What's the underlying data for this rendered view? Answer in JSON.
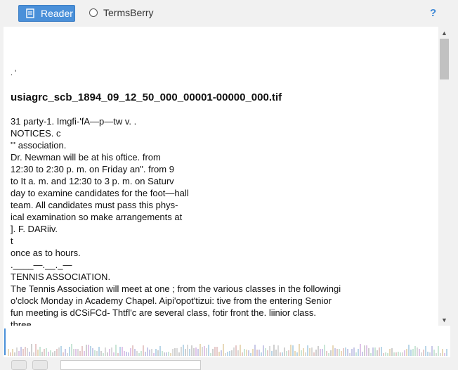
{
  "toolbar": {
    "reader_label": "Reader",
    "termsberry_label": "TermsBerry",
    "help_label": "?"
  },
  "document": {
    "mark": ". '",
    "title": "usiagrc_scb_1894_09_12_50_000_00001-00000_000.tif",
    "lines": [
      "31 party-1. Imgfi-'fA—p—tw v. .",
      "NOTICES. c",
      "\"' association.",
      "Dr. Newman will be at his oftice. from",
      "12:30 to 2:30 p. m. on Friday an\". from 9",
      "to It a. m. and 12:30 to 3 p. m. on Saturv",
      "day to examine candidates for the foot—hall",
      "team. All candidates must pass this phys-",
      "ical examination so make arrangements at",
      "]. F. DARiiv.",
      "t",
      "once as to hours.",
      ".____—.__._—",
      "TENNIS ASSOCIATION.",
      "The Tennis Association will meet at one ; from the various classes in the followingi",
      "o'clock Monday in Academy Chapel. Aipi'opot'tizui: tive from the entering Senior",
      "fun meeting is dCSiFCd- Thtfl'c are several class, fotir front the. liinior class.",
      "three"
    ]
  },
  "scrollbar": {
    "up_icon": "chevron-up-icon",
    "down_icon": "chevron-down-icon"
  },
  "colors": {
    "accent": "#4a90d9",
    "help": "#3a86d6"
  }
}
